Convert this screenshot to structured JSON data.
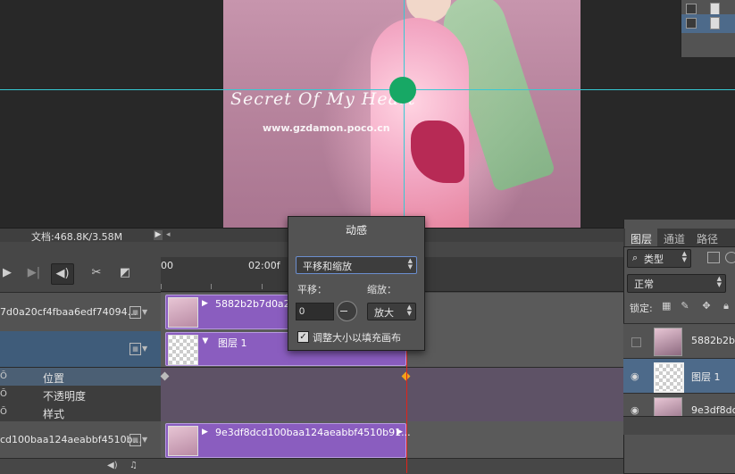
{
  "canvas": {
    "watermark_title": "Secret Of My Heart",
    "watermark_url": "www.gzdamon.poco.cn",
    "guide_color": "#36c9d3",
    "anchor_color": "#17a865"
  },
  "status_bar": {
    "doc_size": "文档:468.8K/3.58M",
    "menu_arrow": "▶",
    "scroll_arrow": "◂"
  },
  "timeline": {
    "ruler_start": "00",
    "ruler_mark": "02:00f",
    "tracks": [
      {
        "header": "7d0a20cf4fbaa6edf74094...",
        "clip": "5882b2b7d0a20"
      },
      {
        "header": "",
        "clip": "图层 1"
      },
      {
        "header": "cd100baa124aeabbf4510b...",
        "clip": "9e3df8dcd100baa124aeabbf4510b91..."
      }
    ],
    "properties": [
      "位置",
      "不透明度",
      "样式"
    ],
    "clip_color": "#8a5dbf",
    "playhead_color": "#e0241a"
  },
  "motion_popup": {
    "title": "动感",
    "preset": "平移和缩放",
    "pan_label": "平移：",
    "zoom_label": "缩放：",
    "pan_value": "0",
    "zoom_value": "放大",
    "resize_label": "调整大小以填充画布",
    "resize_checked": "✓"
  },
  "layers_panel": {
    "tabs": [
      "图层",
      "通道",
      "路径"
    ],
    "kind": "类型",
    "blend_mode": "正常",
    "lock_label": "锁定:",
    "layers": [
      {
        "name": "5882b2b7",
        "visible": false
      },
      {
        "name": "图层 1",
        "visible": true
      },
      {
        "name": "9e3df8dc",
        "visible": true
      }
    ],
    "selection_color": "#4d6a8a"
  }
}
